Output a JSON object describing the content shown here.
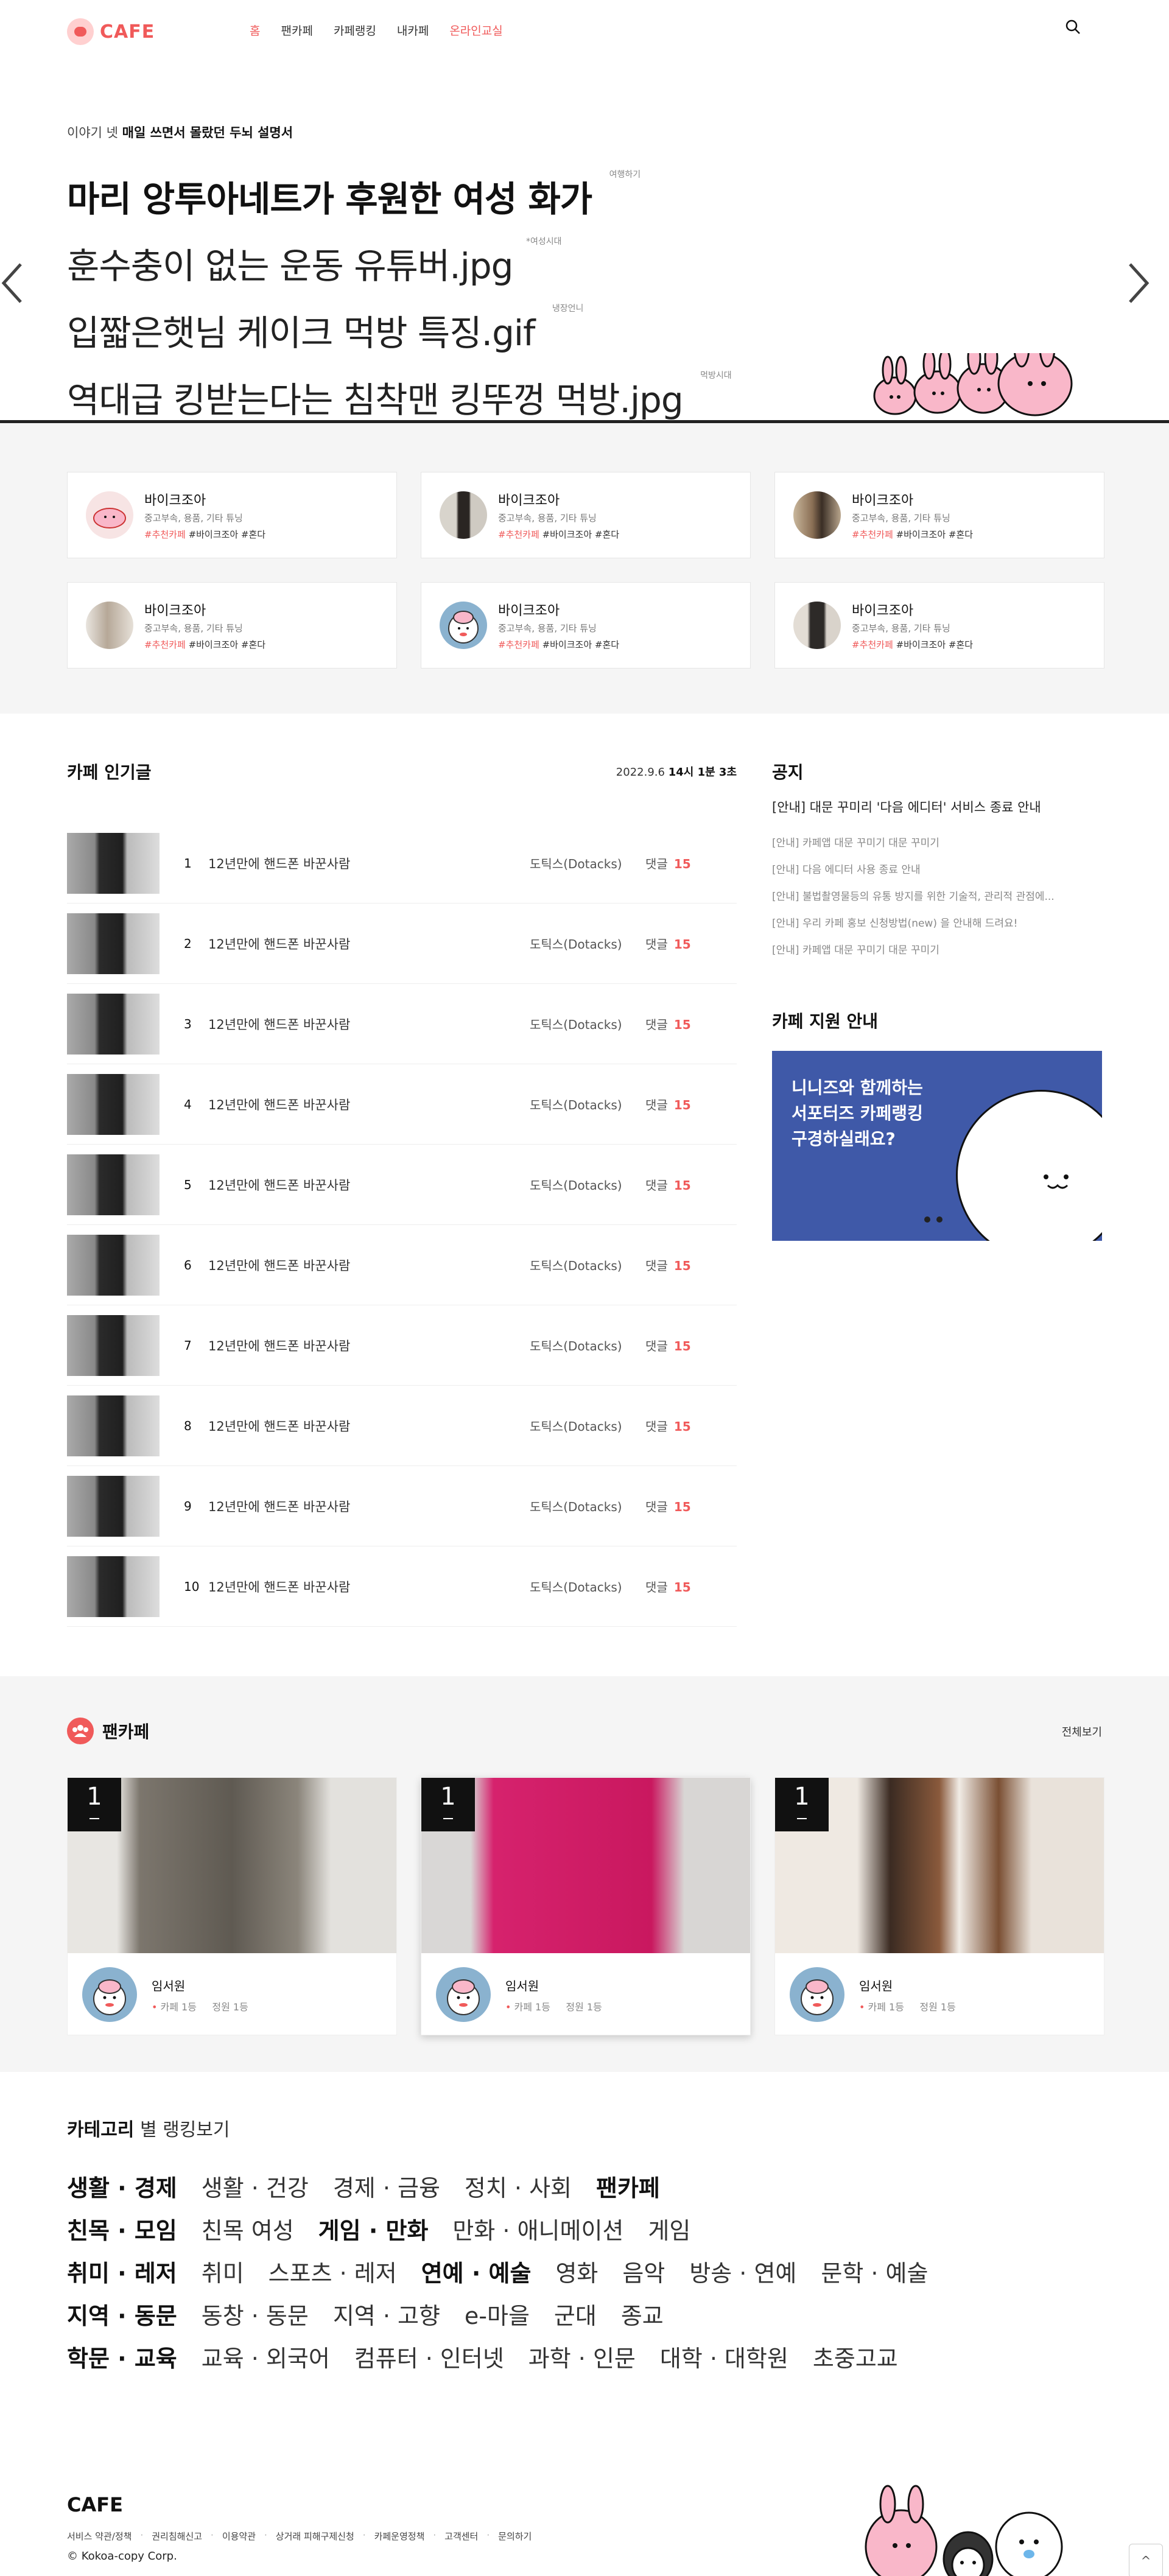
{
  "header": {
    "logo": "CAFE",
    "nav": [
      {
        "label": "홈",
        "active": true
      },
      {
        "label": "팬카페",
        "active": false
      },
      {
        "label": "카페랭킹",
        "active": false
      },
      {
        "label": "내카페",
        "active": false
      },
      {
        "label": "온라인교실",
        "active": false
      }
    ],
    "search_icon": "search-icon"
  },
  "hero": {
    "subtitle_prefix": "이야기 넷",
    "subtitle_bold": "매일 쓰면서 몰랐던 두뇌 설명서",
    "items": [
      {
        "title": "마리 앙투아네트가 후원한 여성 화가",
        "by": "여행하기"
      },
      {
        "title": "훈수충이 없는 운동 유튜버.jpg",
        "by": "*여성시대"
      },
      {
        "title": "입짧은햇님 케이크 먹방 특징.gif",
        "by": "냉장언니"
      },
      {
        "title": "역대급 킹받는다는 침착맨 킹뚜껑 먹방.jpg",
        "by": "먹방시대"
      }
    ]
  },
  "featured": [
    {
      "name": "바이크조아",
      "desc": "중고부속, 용품, 기타 튜닝",
      "tags": [
        "#추천카페",
        "#바이크조아",
        "#혼다"
      ]
    },
    {
      "name": "바이크조아",
      "desc": "중고부속, 용품, 기타 튜닝",
      "tags": [
        "#추천카페",
        "#바이크조아",
        "#혼다"
      ]
    },
    {
      "name": "바이크조아",
      "desc": "중고부속, 용품, 기타 튜닝",
      "tags": [
        "#추천카페",
        "#바이크조아",
        "#혼다"
      ]
    },
    {
      "name": "바이크조아",
      "desc": "중고부속, 용품, 기타 튜닝",
      "tags": [
        "#추천카페",
        "#바이크조아",
        "#혼다"
      ]
    },
    {
      "name": "바이크조아",
      "desc": "중고부속, 용품, 기타 튜닝",
      "tags": [
        "#추천카페",
        "#바이크조아",
        "#혼다"
      ]
    },
    {
      "name": "바이크조아",
      "desc": "중고부속, 용품, 기타 튜닝",
      "tags": [
        "#추천카페",
        "#바이크조아",
        "#혼다"
      ]
    }
  ],
  "popular": {
    "title": "카페 인기글",
    "date": "2022.9.6",
    "time": "14시 1분 3초",
    "comment_label": "댓글",
    "rows": [
      {
        "num": "1",
        "title": "12년만에 핸드폰 바꾼사람",
        "author": "도틱스(Dotacks)",
        "comments": "15"
      },
      {
        "num": "2",
        "title": "12년만에 핸드폰 바꾼사람",
        "author": "도틱스(Dotacks)",
        "comments": "15"
      },
      {
        "num": "3",
        "title": "12년만에 핸드폰 바꾼사람",
        "author": "도틱스(Dotacks)",
        "comments": "15"
      },
      {
        "num": "4",
        "title": "12년만에 핸드폰 바꾼사람",
        "author": "도틱스(Dotacks)",
        "comments": "15"
      },
      {
        "num": "5",
        "title": "12년만에 핸드폰 바꾼사람",
        "author": "도틱스(Dotacks)",
        "comments": "15"
      },
      {
        "num": "6",
        "title": "12년만에 핸드폰 바꾼사람",
        "author": "도틱스(Dotacks)",
        "comments": "15"
      },
      {
        "num": "7",
        "title": "12년만에 핸드폰 바꾼사람",
        "author": "도틱스(Dotacks)",
        "comments": "15"
      },
      {
        "num": "8",
        "title": "12년만에 핸드폰 바꾼사람",
        "author": "도틱스(Dotacks)",
        "comments": "15"
      },
      {
        "num": "9",
        "title": "12년만에 핸드폰 바꾼사람",
        "author": "도틱스(Dotacks)",
        "comments": "15"
      },
      {
        "num": "10",
        "title": "12년만에 핸드폰 바꾼사람",
        "author": "도틱스(Dotacks)",
        "comments": "15"
      }
    ]
  },
  "notice": {
    "title": "공지",
    "main": "[안내] 대문 꾸미리 '다음 에디터' 서비스 종료 안내",
    "items": [
      "[안내] 카페앱 대문 꾸미기 대문 꾸미기",
      "[안내] 다음 에디터 사용 종료 안내",
      "[안내] 불법촬영물등의 유통 방지를 위한 기술적, 관리적 관점에...",
      "[안내] 우리 카페 홍보 신청방법(new) 을 안내해 드려요!",
      "[안내] 카페앱 대문 꾸미기 대문 꾸미기"
    ]
  },
  "support": {
    "title": "카페 지원 안내",
    "banner_lines": [
      "니니즈와 함께하는",
      "서포터즈 카페랭킹",
      "구경하실래요?"
    ]
  },
  "fancafe": {
    "title": "팬카페",
    "view_all": "전체보기",
    "cards": [
      {
        "rank": "1",
        "name": "임서원",
        "meta": "카페 1등",
        "members": "정원 1등"
      },
      {
        "rank": "1",
        "name": "임서원",
        "meta": "카페 1등",
        "members": "정원 1등"
      },
      {
        "rank": "1",
        "name": "임서원",
        "meta": "카페 1등",
        "members": "정원 1등"
      }
    ]
  },
  "category": {
    "title_bold": "카테고리",
    "title_rest": "별 랭킹보기",
    "rows": [
      {
        "lead": "생활 · 경제",
        "items": [
          {
            "t": "생활 · 건강",
            "b": false
          },
          {
            "t": "경제 · 금융",
            "b": false
          },
          {
            "t": "정치 · 사회",
            "b": false
          },
          {
            "t": "팬카페",
            "b": true
          }
        ]
      },
      {
        "lead": "친목 · 모임",
        "items": [
          {
            "t": "친목 여성",
            "b": false
          },
          {
            "t": "게임 · 만화",
            "b": true
          },
          {
            "t": "만화 · 애니메이션",
            "b": false
          },
          {
            "t": "게임",
            "b": false
          }
        ]
      },
      {
        "lead": "취미 · 레저",
        "items": [
          {
            "t": "취미",
            "b": false
          },
          {
            "t": "스포츠 · 레저",
            "b": false
          },
          {
            "t": "연예 · 예술",
            "b": true
          },
          {
            "t": "영화",
            "b": false
          },
          {
            "t": "음악",
            "b": false
          },
          {
            "t": "방송 · 연예",
            "b": false
          },
          {
            "t": "문학 · 예술",
            "b": false
          }
        ]
      },
      {
        "lead": "지역 · 동문",
        "items": [
          {
            "t": "동창 · 동문",
            "b": false
          },
          {
            "t": "지역 · 고향",
            "b": false
          },
          {
            "t": "e-마을",
            "b": false
          },
          {
            "t": "군대",
            "b": false
          },
          {
            "t": "종교",
            "b": false
          }
        ]
      },
      {
        "lead": "학문 · 교육",
        "items": [
          {
            "t": "교육 · 외국어",
            "b": false
          },
          {
            "t": "컴퓨터 · 인터넷",
            "b": false
          },
          {
            "t": "과학 · 인문",
            "b": false
          },
          {
            "t": "대학 · 대학원",
            "b": false
          },
          {
            "t": "초중고교",
            "b": false
          }
        ]
      }
    ]
  },
  "footer": {
    "logo": "CAFE",
    "links": [
      "서비스 약관/정책",
      "권리침해신고",
      "이용약관",
      "상거래 피해구제신청",
      "카페운영정책",
      "고객센터",
      "문의하기"
    ],
    "copyright": "© Kokoa-copy Corp.",
    "top_label": "^"
  },
  "colors": {
    "accent": "#f05a5a",
    "banner": "#3f59a8",
    "section_bg": "#f5f5f5"
  }
}
